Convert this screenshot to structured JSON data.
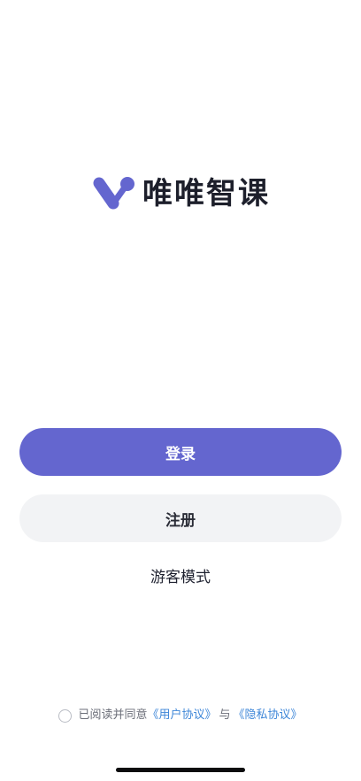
{
  "brand": {
    "app_name": "唯唯智课",
    "logo_icon": "v-molecule-logo-icon",
    "logo_color": "#6466cf"
  },
  "actions": {
    "login_label": "登录",
    "register_label": "注册",
    "guest_label": "游客模式"
  },
  "agreement": {
    "prefix": "已阅读并同意",
    "user_agreement": "《用户协议》",
    "conjunction": "与",
    "privacy_policy": "《隐私协议》",
    "checked": false
  },
  "colors": {
    "primary": "#6466cf",
    "secondary_bg": "#f2f3f5",
    "link": "#3d86d8"
  }
}
